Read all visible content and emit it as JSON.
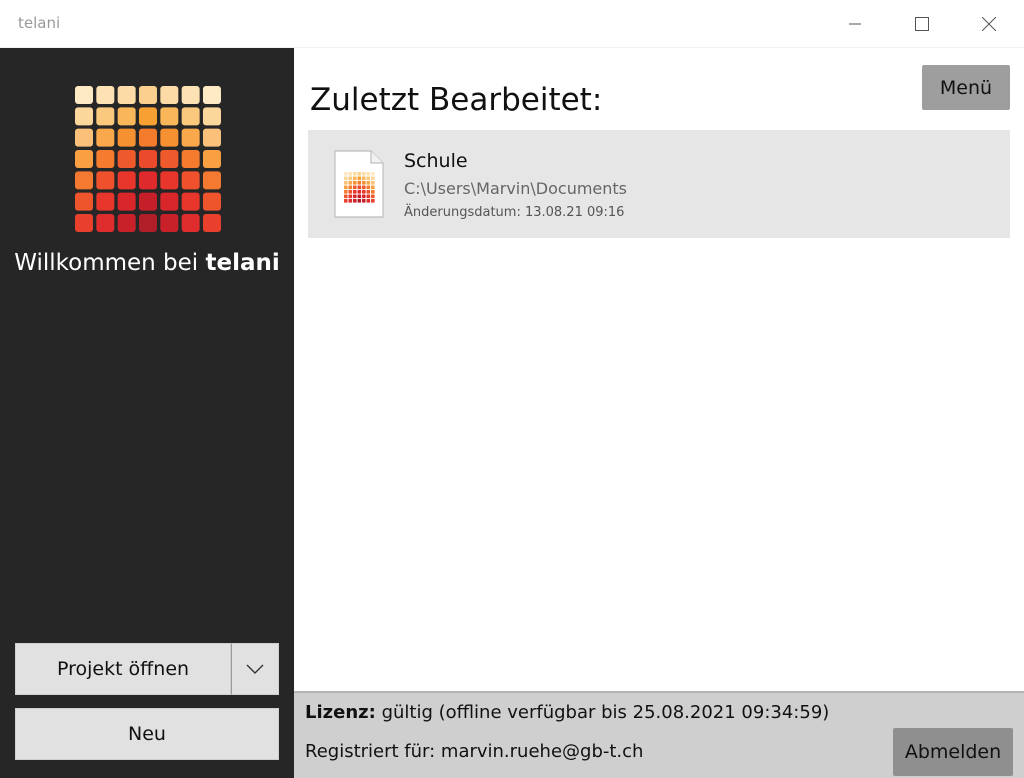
{
  "window": {
    "title": "telani",
    "controls": {
      "minimize": "minimize-icon",
      "maximize": "maximize-icon",
      "close": "close-icon"
    }
  },
  "sidebar": {
    "welcome_prefix": "Willkommen bei",
    "welcome_brand": "telani",
    "open_project_label": "Projekt öffnen",
    "new_label": "Neu",
    "logo": "telani-grid-logo"
  },
  "main": {
    "heading": "Zuletzt Bearbeitet:",
    "menu_label": "Menü",
    "recent": [
      {
        "name": "Schule",
        "path": "C:\\Users\\Marvin\\Documents",
        "modified": "Änderungsdatum: 13.08.21 09:16",
        "icon": "project-file-icon"
      }
    ]
  },
  "footer": {
    "license_label": "Lizenz:",
    "license_text": "gültig (offline verfügbar bis 25.08.2021 09:34:59)",
    "registered_text": "Registriert für: marvin.ruehe@gb-t.ch",
    "logout_label": "Abmelden"
  },
  "colors": {
    "sidebar_bg": "#262626",
    "logo_light": "#fde3b4",
    "logo_orange": "#f8a132",
    "logo_red": "#e8312d",
    "logo_dark_red": "#b01e28"
  }
}
